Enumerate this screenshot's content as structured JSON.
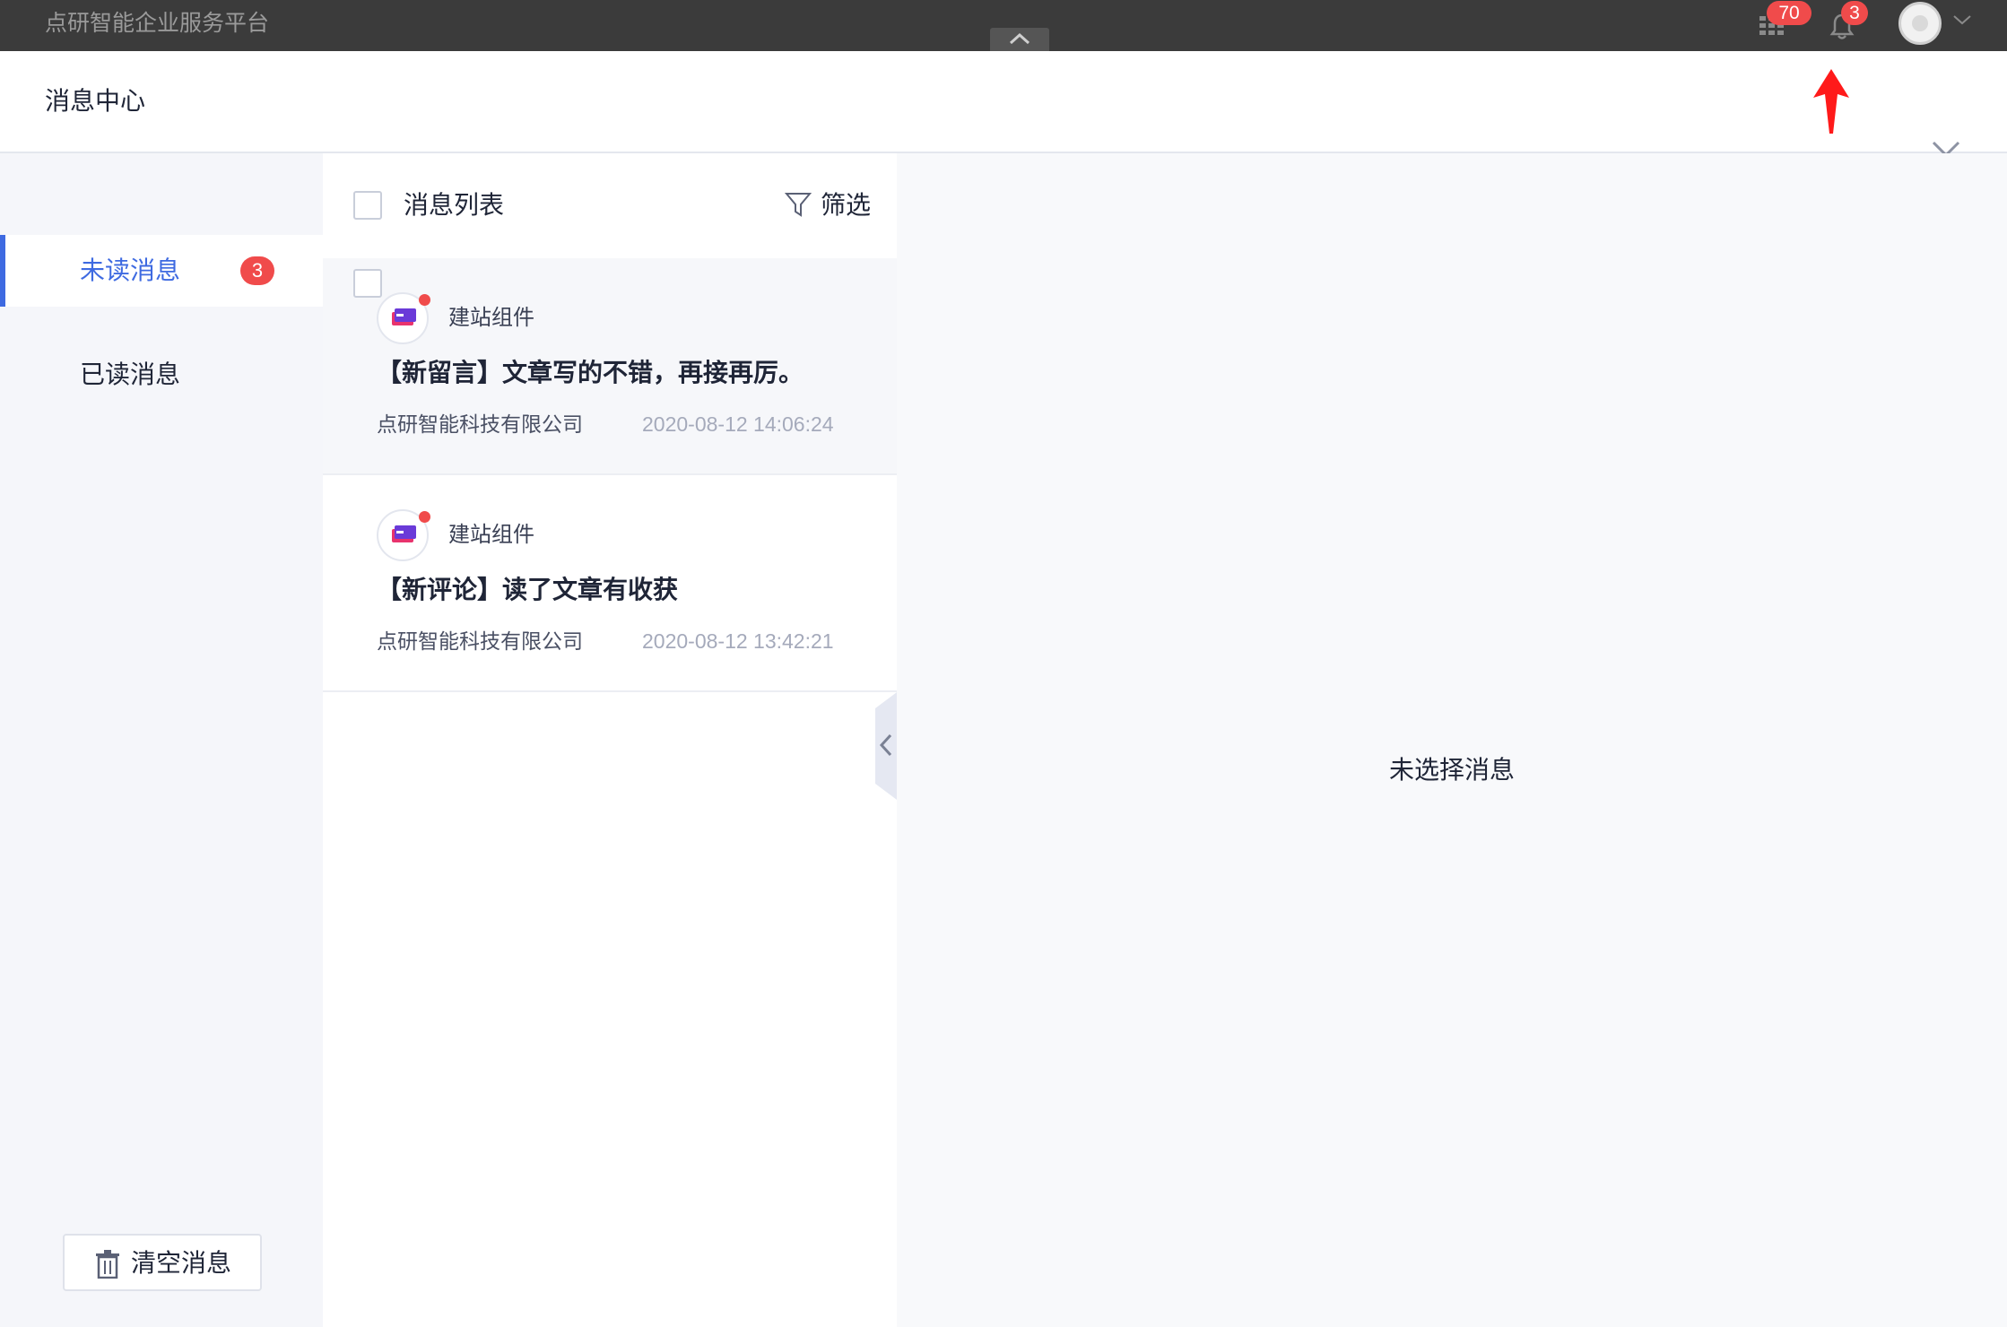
{
  "topbar": {
    "brand": "点研智能企业服务平台",
    "apps_badge": "70",
    "bell_badge": "3",
    "icons": {
      "collapse": "chevron-up-icon",
      "apps": "grid-icon",
      "bell": "bell-icon",
      "avatar": "avatar",
      "caret": "chevron-down-icon"
    }
  },
  "header": {
    "title": "消息中心",
    "close_icon": "close-icon",
    "annotation_color": "#ff1a1a"
  },
  "sidebar": {
    "items": [
      {
        "label": "未读消息",
        "count": "3",
        "active": true
      },
      {
        "label": "已读消息",
        "active": false
      }
    ],
    "clear_label": "清空消息",
    "accent_color": "#3e6ae1"
  },
  "list": {
    "title": "消息列表",
    "filter_label": "筛选",
    "messages": [
      {
        "source": "建站组件",
        "title": "【新留言】文章写的不错，再接再厉。",
        "company": "点研智能科技有限公司",
        "time": "2020-08-12 14:06:24",
        "unread": true
      },
      {
        "source": "建站组件",
        "title": "【新评论】读了文章有收获",
        "company": "点研智能科技有限公司",
        "time": "2020-08-12 13:42:21",
        "unread": true
      }
    ]
  },
  "detail": {
    "empty_text": "未选择消息"
  }
}
